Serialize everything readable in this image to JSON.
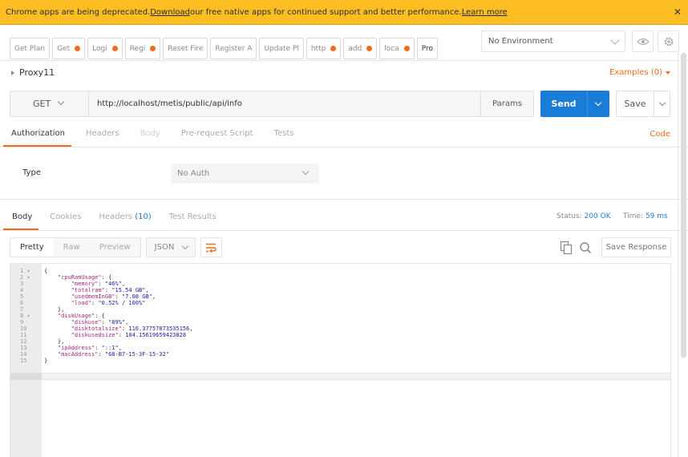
{
  "banner": {
    "text_before": "Chrome apps are being deprecated. ",
    "download_link": "Download",
    "text_after": " our free native apps for continued support and better performance. ",
    "learn_more_link": "Learn more",
    "close": "✕"
  },
  "tabs": [
    {
      "label": "Get Plan",
      "dot": false
    },
    {
      "label": "Get",
      "dot": true
    },
    {
      "label": "Logi",
      "dot": true
    },
    {
      "label": "Regi",
      "dot": true
    },
    {
      "label": "Reset Fire",
      "dot": false
    },
    {
      "label": "Register A",
      "dot": false
    },
    {
      "label": "Update Pl",
      "dot": false
    },
    {
      "label": "http",
      "dot": true
    },
    {
      "label": "add",
      "dot": true
    },
    {
      "label": "loca",
      "dot": true
    },
    {
      "label": "Pro",
      "dot": false
    }
  ],
  "environment": {
    "selected": "No Environment"
  },
  "collection": {
    "name": "Proxy11",
    "examples": "Examples (0)"
  },
  "request": {
    "method": "GET",
    "url": "http://localhost/metis/public/api/info",
    "params_label": "Params",
    "send_label": "Send",
    "save_label": "Save"
  },
  "request_tabs": [
    "Authorization",
    "Headers",
    "Body",
    "Pre-request Script",
    "Tests"
  ],
  "code_link": "Code",
  "auth": {
    "type_label": "Type",
    "selected": "No Auth"
  },
  "response": {
    "tabs": {
      "body": "Body",
      "cookies": "Cookies",
      "headers": "Headers",
      "headers_count": "(10)",
      "test_results": "Test Results"
    },
    "status_label": "Status:",
    "status_value": "200 OK",
    "time_label": "Time:",
    "time_value": "59 ms",
    "views": [
      "Pretty",
      "Raw",
      "Preview"
    ],
    "format": "JSON",
    "save_response": "Save Response"
  },
  "code_lines": [
    {
      "n": "1",
      "fold": true,
      "text": "{"
    },
    {
      "n": "2",
      "fold": true,
      "text": "    \"cpuRamUsage\": {"
    },
    {
      "n": "3",
      "fold": false,
      "text": "        \"memory\": \"46%\","
    },
    {
      "n": "4",
      "fold": false,
      "text": "        \"totalram\": \"15.54 GB\","
    },
    {
      "n": "5",
      "fold": false,
      "text": "        \"usedmemInGB\": \"7.08 GB\","
    },
    {
      "n": "6",
      "fold": false,
      "text": "        \"load\": \"0.52% / 100%\""
    },
    {
      "n": "7",
      "fold": false,
      "text": "    },"
    },
    {
      "n": "8",
      "fold": true,
      "text": "    \"diskUsage\": {"
    },
    {
      "n": "9",
      "fold": false,
      "text": "        \"diskuse\": \"89%\","
    },
    {
      "n": "10",
      "fold": false,
      "text": "        \"disktotalsize\": 116.37757873535156,"
    },
    {
      "n": "11",
      "fold": false,
      "text": "        \"diskusedsize\": 104.15619659423828"
    },
    {
      "n": "12",
      "fold": false,
      "text": "    },"
    },
    {
      "n": "13",
      "fold": false,
      "text": "    \"ipAddress\": \"::1\","
    },
    {
      "n": "14",
      "fold": false,
      "text": "    \"macAddress\": \"68-B7-15-3F-15-32\""
    },
    {
      "n": "15",
      "fold": false,
      "text": "}"
    }
  ],
  "colors": {
    "accent": "#f26b1d",
    "primary": "#197dd8",
    "banner": "#fdbe24"
  }
}
